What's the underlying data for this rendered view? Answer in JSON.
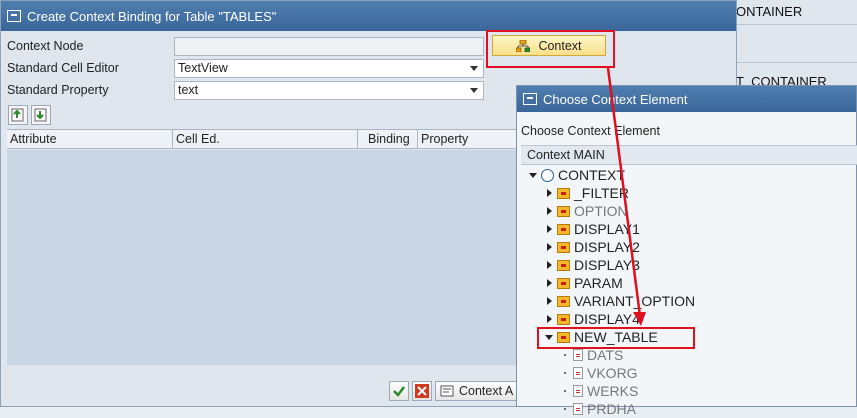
{
  "background": {
    "label_top": "ONTAINER",
    "label_mid": "T_CONTAINER"
  },
  "dialog": {
    "title": "Create Context Binding for Table \"TABLES\"",
    "fields": [
      {
        "label": "Context Node",
        "value": ""
      },
      {
        "label": "Standard Cell Editor",
        "value": "TextView"
      },
      {
        "label": "Standard Property",
        "value": "text"
      }
    ],
    "context_button": "Context",
    "columns": [
      "Attribute",
      "Cell Ed.",
      "Binding",
      "Property"
    ],
    "footer_button": "Context A"
  },
  "chooser": {
    "title": "Choose Context Element",
    "subtitle": "Choose Context Element",
    "header": "Context MAIN",
    "root": "CONTEXT",
    "nodes": [
      {
        "label": "_FILTER",
        "state": "closed",
        "muted": false
      },
      {
        "label": "OPTION",
        "state": "closed",
        "muted": true
      },
      {
        "label": "DISPLAY1",
        "state": "closed",
        "muted": false
      },
      {
        "label": "DISPLAY2",
        "state": "closed",
        "muted": false
      },
      {
        "label": "DISPLAY3",
        "state": "closed",
        "muted": false
      },
      {
        "label": "PARAM",
        "state": "closed",
        "muted": false
      },
      {
        "label": "VARIANT_OPTION",
        "state": "closed",
        "muted": false
      },
      {
        "label": "DISPLAY4",
        "state": "closed",
        "muted": false
      },
      {
        "label": "NEW_TABLE",
        "state": "open",
        "muted": false
      }
    ],
    "attributes": [
      "DATS",
      "VKORG",
      "WERKS",
      "PRDHA"
    ]
  },
  "colors": {
    "highlight": "#e01020",
    "titlebar": "#3b6699",
    "context_button": "#f8e08a"
  }
}
